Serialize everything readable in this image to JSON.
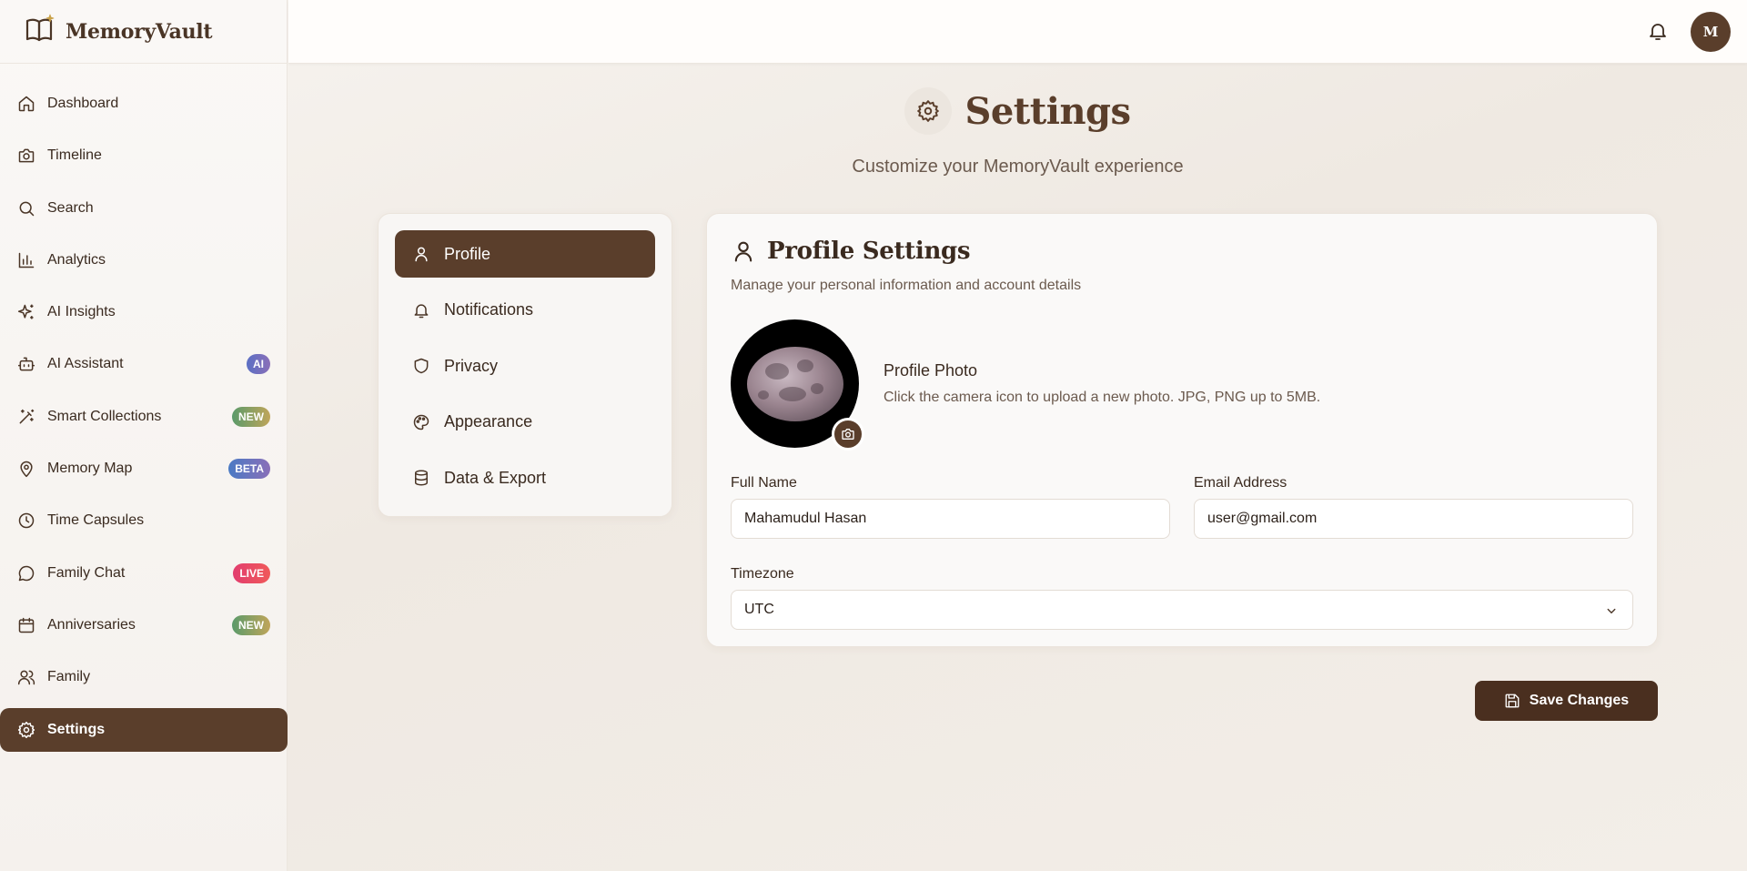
{
  "brand": {
    "name": "MemoryVault"
  },
  "sidebar": {
    "items": [
      {
        "label": "Dashboard",
        "icon": "home-icon"
      },
      {
        "label": "Timeline",
        "icon": "camera-icon"
      },
      {
        "label": "Search",
        "icon": "search-icon"
      },
      {
        "label": "Analytics",
        "icon": "bar-chart-icon"
      },
      {
        "label": "AI Insights",
        "icon": "sparkles-icon"
      },
      {
        "label": "AI Assistant",
        "icon": "robot-icon",
        "badge": "AI",
        "badge_color": "#6b6fc0"
      },
      {
        "label": "Smart Collections",
        "icon": "magic-wand-icon",
        "badge": "NEW",
        "badge_color": "#7a9a5a"
      },
      {
        "label": "Memory Map",
        "icon": "map-pin-icon",
        "badge": "BETA",
        "badge_color": "#5b6fc4"
      },
      {
        "label": "Time Capsules",
        "icon": "clock-icon"
      },
      {
        "label": "Family Chat",
        "icon": "chat-bubble-icon",
        "badge": "LIVE",
        "badge_color": "#e23d6e"
      },
      {
        "label": "Anniversaries",
        "icon": "calendar-icon",
        "badge": "NEW",
        "badge_color": "#7a9a5a"
      },
      {
        "label": "Family",
        "icon": "users-icon"
      },
      {
        "label": "Settings",
        "icon": "gear-icon",
        "active": true
      }
    ]
  },
  "topbar": {
    "avatar_initial": "M"
  },
  "header": {
    "title": "Settings",
    "subtitle": "Customize your MemoryVault experience"
  },
  "settings_menu": {
    "items": [
      {
        "label": "Profile",
        "icon": "user-icon",
        "active": true
      },
      {
        "label": "Notifications",
        "icon": "bell-icon"
      },
      {
        "label": "Privacy",
        "icon": "shield-icon"
      },
      {
        "label": "Appearance",
        "icon": "palette-icon"
      },
      {
        "label": "Data & Export",
        "icon": "database-icon"
      }
    ]
  },
  "profile": {
    "title": "Profile Settings",
    "subtitle": "Manage your personal information and account details",
    "photo_title": "Profile Photo",
    "photo_desc": "Click the camera icon to upload a new photo. JPG, PNG up to 5MB.",
    "full_name_label": "Full Name",
    "full_name_value": "Mahamudul Hasan",
    "email_label": "Email Address",
    "email_value": "user@gmail.com",
    "timezone_label": "Timezone",
    "timezone_value": "UTC"
  },
  "actions": {
    "save_label": "Save Changes"
  },
  "colors": {
    "accent": "#5a3e2b",
    "background": "#f3eee8"
  }
}
